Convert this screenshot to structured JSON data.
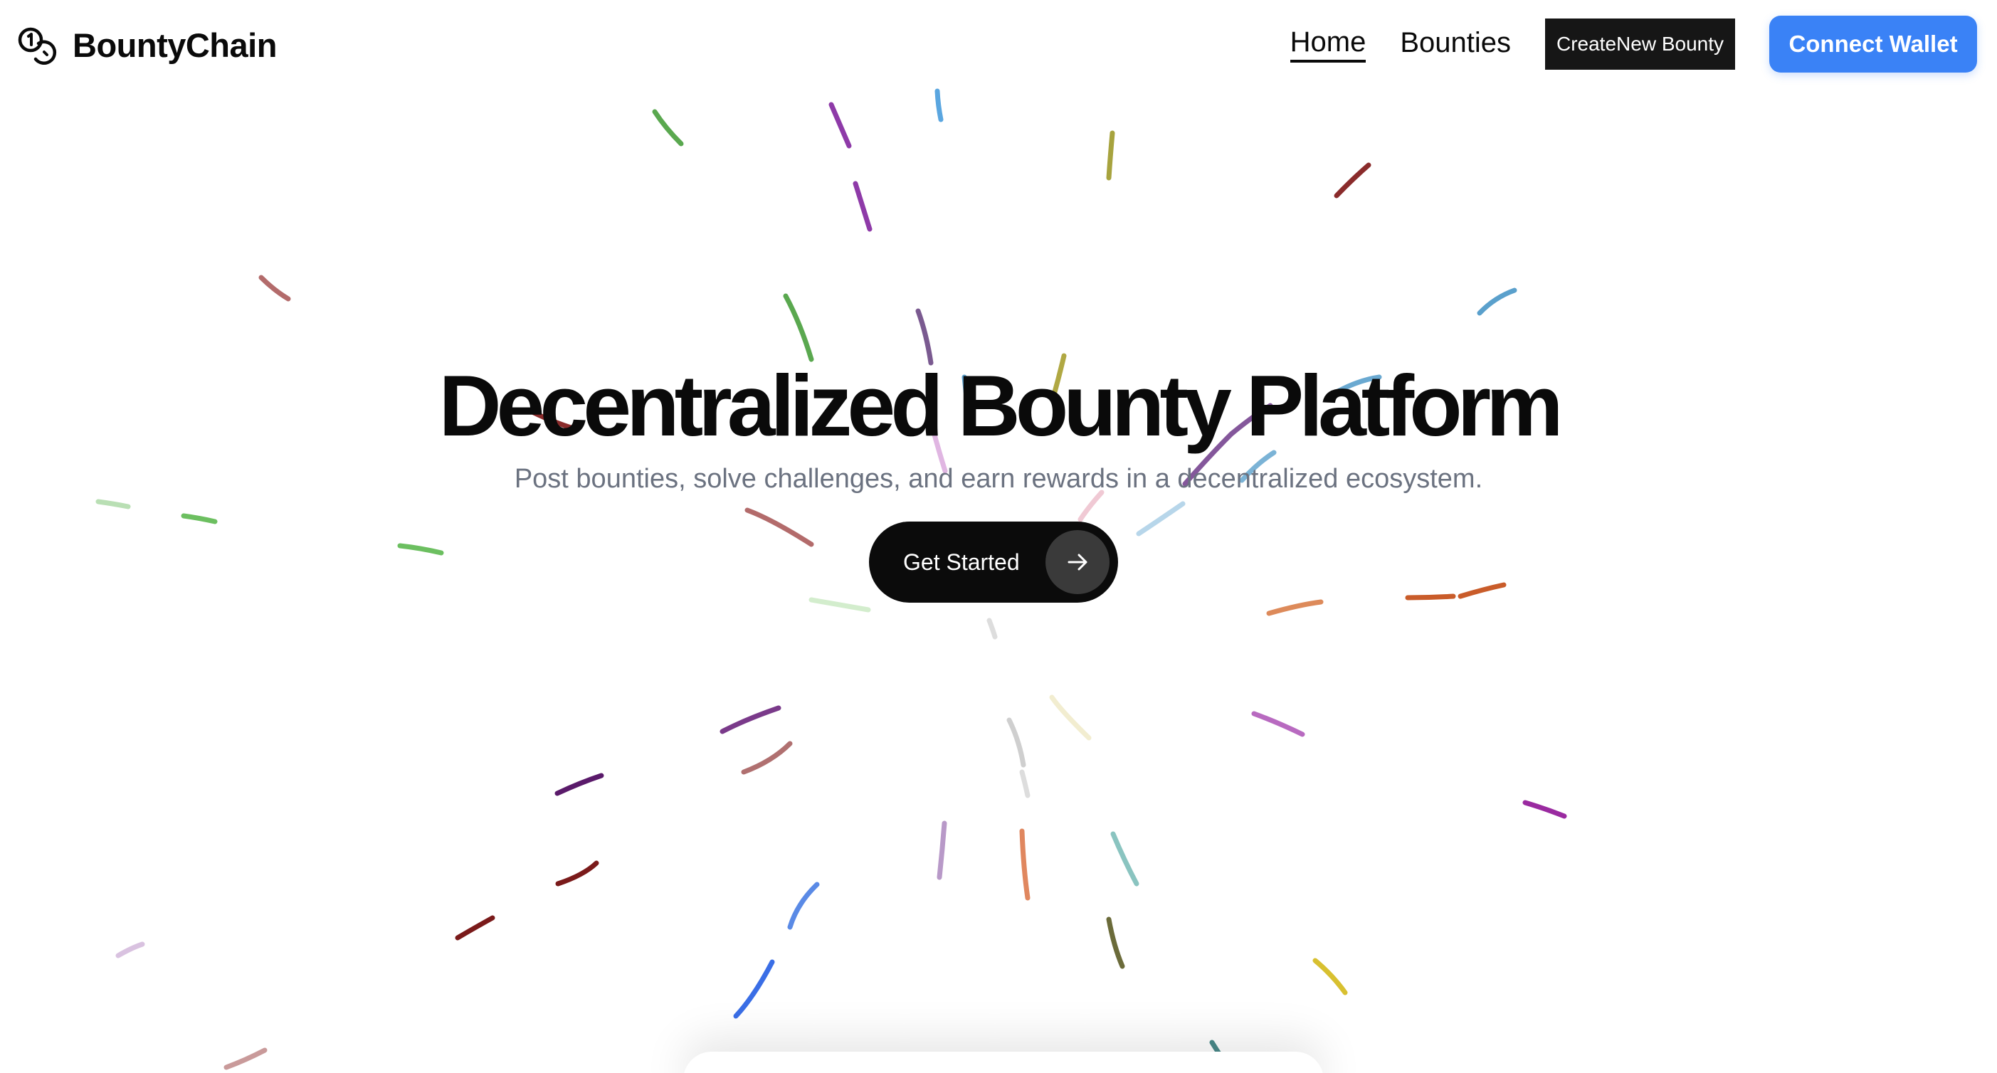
{
  "header": {
    "logo_text": "BountyChain",
    "logo_icon": "coins-icon",
    "nav": {
      "home": "Home",
      "bounties": "Bounties",
      "create": "CreateNew Bounty",
      "connect": "Connect Wallet"
    }
  },
  "hero": {
    "title": "Decentralized Bounty Platform",
    "subtitle": "Post bounties, solve challenges, and earn rewards in a decentralized ecosystem.",
    "cta_label": "Get Started",
    "cta_icon": "arrow-right-icon"
  },
  "colors": {
    "accent_blue": "#3a82f6",
    "dark": "#0b0b0b",
    "subtitle_gray": "#6b7280"
  }
}
